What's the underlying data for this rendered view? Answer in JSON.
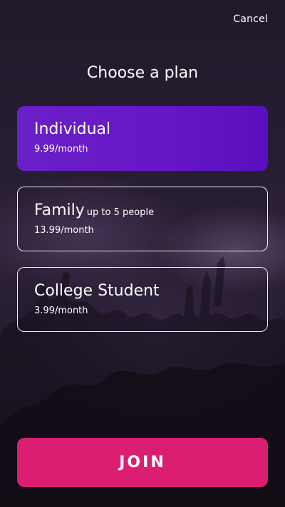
{
  "header": {
    "cancel_label": "Cancel",
    "title": "Choose a plan"
  },
  "plans": [
    {
      "name": "Individual",
      "note": "",
      "price": "9.99/month",
      "selected": true
    },
    {
      "name": "Family",
      "note": "up to 5 people",
      "price": "13.99/month",
      "selected": false
    },
    {
      "name": "College Student",
      "note": "",
      "price": "3.99/month",
      "selected": false
    }
  ],
  "actions": {
    "join_label": "JOIN"
  },
  "colors": {
    "selected_plan": "#6a1fc8",
    "join_button": "#dc1e72",
    "background": "#271d31"
  }
}
